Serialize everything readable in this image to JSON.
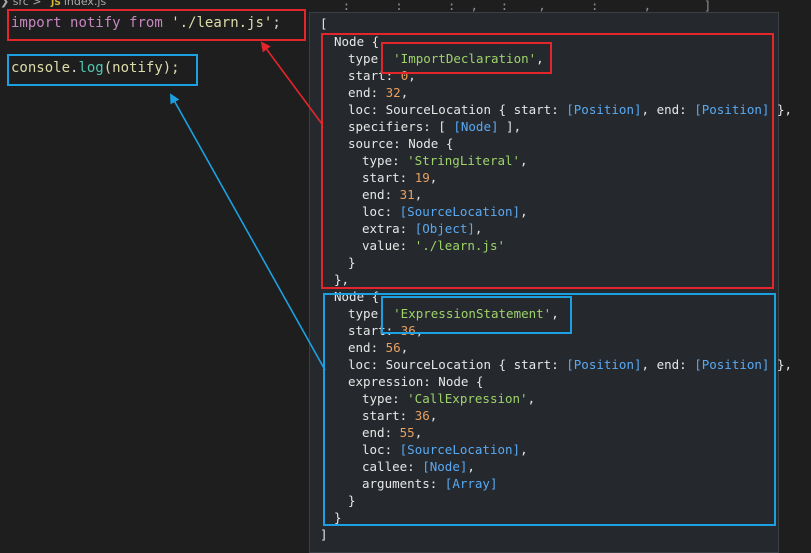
{
  "breadcrumb": {
    "folder": "src",
    "separator": ">",
    "file_icon": "JS",
    "file": "index.js"
  },
  "code": {
    "line1": {
      "import": "import",
      "name": "notify",
      "from": "from",
      "path": "'./learn.js'",
      "semicolon": ";"
    },
    "line2": {
      "object": "console",
      "dot": ".",
      "method": "log",
      "args": "(notify);"
    }
  },
  "output": {
    "open_bracket": "[",
    "close_bracket": "]",
    "node1": {
      "header": "Node {",
      "type_key": "type: ",
      "type_val": "'ImportDeclaration'",
      "type_tail": ",",
      "start_key": "start: ",
      "start_val": "0",
      "comma": ",",
      "end_key": "end: ",
      "end_val": "32",
      "loc_key": "loc: SourceLocation { start: ",
      "loc_pos1": "[Position]",
      "loc_mid": ", end: ",
      "loc_pos2": "[Position]",
      "loc_tail": " },",
      "spec_key": "specifiers: [ ",
      "spec_val": "[Node]",
      "spec_tail": " ],",
      "source_header": "source: Node {",
      "s_type_key": "type: ",
      "s_type_val": "'StringLiteral'",
      "s_start_key": "start: ",
      "s_start_val": "19",
      "s_end_key": "end: ",
      "s_end_val": "31",
      "s_loc_key": "loc: ",
      "s_loc_val": "[SourceLocation]",
      "s_extra_key": "extra: ",
      "s_extra_val": "[Object]",
      "s_value_key": "value: ",
      "s_value_val": "'./learn.js'",
      "inner_close": "}",
      "outer_close": "},"
    },
    "node2": {
      "header": "Node {",
      "type_key": "type: ",
      "type_val": "'ExpressionStatement'",
      "type_tail": ",",
      "start_key": "start: ",
      "start_val": "36",
      "end_key": "end: ",
      "end_val": "56",
      "loc_key": "loc: SourceLocation { start: ",
      "loc_pos1": "[Position]",
      "loc_mid": ", end: ",
      "loc_pos2": "[Position]",
      "loc_tail": " },",
      "expr_header": "expression: Node {",
      "e_type_key": "type: ",
      "e_type_val": "'CallExpression'",
      "e_start_key": "start: ",
      "e_start_val": "36",
      "e_end_key": "end: ",
      "e_end_val": "55",
      "e_loc_key": "loc: ",
      "e_loc_val": "[SourceLocation]",
      "e_callee_key": "callee: ",
      "e_callee_val": "[Node]",
      "e_args_key": "arguments: ",
      "e_args_val": "[Array]",
      "inner_close": "}",
      "outer_close": "}"
    }
  },
  "colors": {
    "red_annotation": "#e2262b",
    "blue_annotation": "#1ba1e2",
    "string": "#9ed36a",
    "number": "#e8a060",
    "link": "#59a9f2"
  }
}
